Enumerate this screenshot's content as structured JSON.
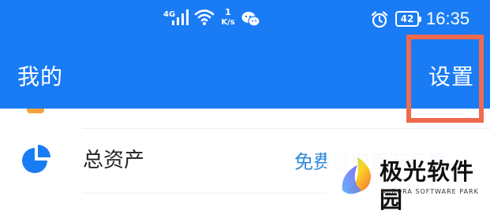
{
  "status_bar": {
    "network_type": "4G",
    "speed_value": "1",
    "speed_unit": "K/s",
    "battery": "42",
    "time": "16:35",
    "icons": [
      "signal-icon",
      "wifi-icon",
      "wechat-icon",
      "alarm-icon",
      "battery-icon"
    ]
  },
  "header": {
    "title": "我的",
    "settings_label": "设置"
  },
  "annotation": {
    "highlight_color": "#f06a4e"
  },
  "colors": {
    "header_bg": "#1a7cf5",
    "promo_text": "#2d89d8",
    "tab_accent": "#f6a23c"
  },
  "list": {
    "items": [
      {
        "label": "总资产",
        "promo": "免费领取百万保障",
        "icon": "pie-chart-icon"
      }
    ]
  },
  "watermark": {
    "name": "极光软件园",
    "sub": "AURORA SOFTWARE PARK"
  }
}
